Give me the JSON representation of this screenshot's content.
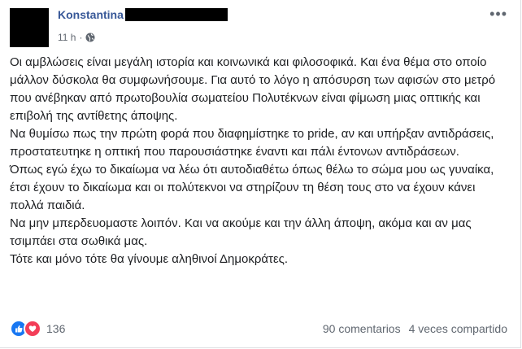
{
  "post": {
    "author_name": "Konstantina",
    "timestamp": "11 h",
    "separator": "·",
    "privacy_icon": "globe-icon",
    "more_icon": "ellipsis-icon",
    "paragraphs": [
      "Οι αμβλώσεις είναι μεγάλη ιστορία και κοινωνικά και φιλοσοφικά. Και ένα θέμα στο οποίο μάλλον δύσκολα θα συμφωνήσουμε. Για αυτό το λόγο η απόσυρση των αφισών στο μετρό που ανέβηκαν από πρωτοβουλία σωματείου Πολυτέκνων είναι φίμωση μιας οπτικής και επιβολή της αντίθετης άποψης.",
      "Να θυμίσω πως την πρώτη φορά που διαφημίστηκε το pride, αν και υπήρξαν αντιδράσεις, προστατευτηκε η οπτική που παρουσιάστηκε έναντι και πάλι έντονων αντιδράσεων.",
      "Όπως εγώ έχω το δικαίωμα να λέω ότι αυτοδιαθέτω όπως θέλω το σώμα μου ως γυναίκα, έτσι έχουν το δικαίωμα και οι πολύτεκνοι να στηρίζουν τη θέση τους στο να έχουν κάνει πολλά παιδιά.",
      "Να μην μπερδευομαστε λοιπόν. Και να ακούμε και την άλλη άποψη, ακόμα και αν μας τσιμπάει στα σωθικά μας.",
      "Τότε και μόνο τότε θα γίνουμε αληθινοί Δημοκράτες."
    ]
  },
  "footer": {
    "reaction_icons": [
      "like-icon",
      "love-icon"
    ],
    "reaction_count": "136",
    "comments": "90 comentarios",
    "shares": "4 veces compartido"
  }
}
